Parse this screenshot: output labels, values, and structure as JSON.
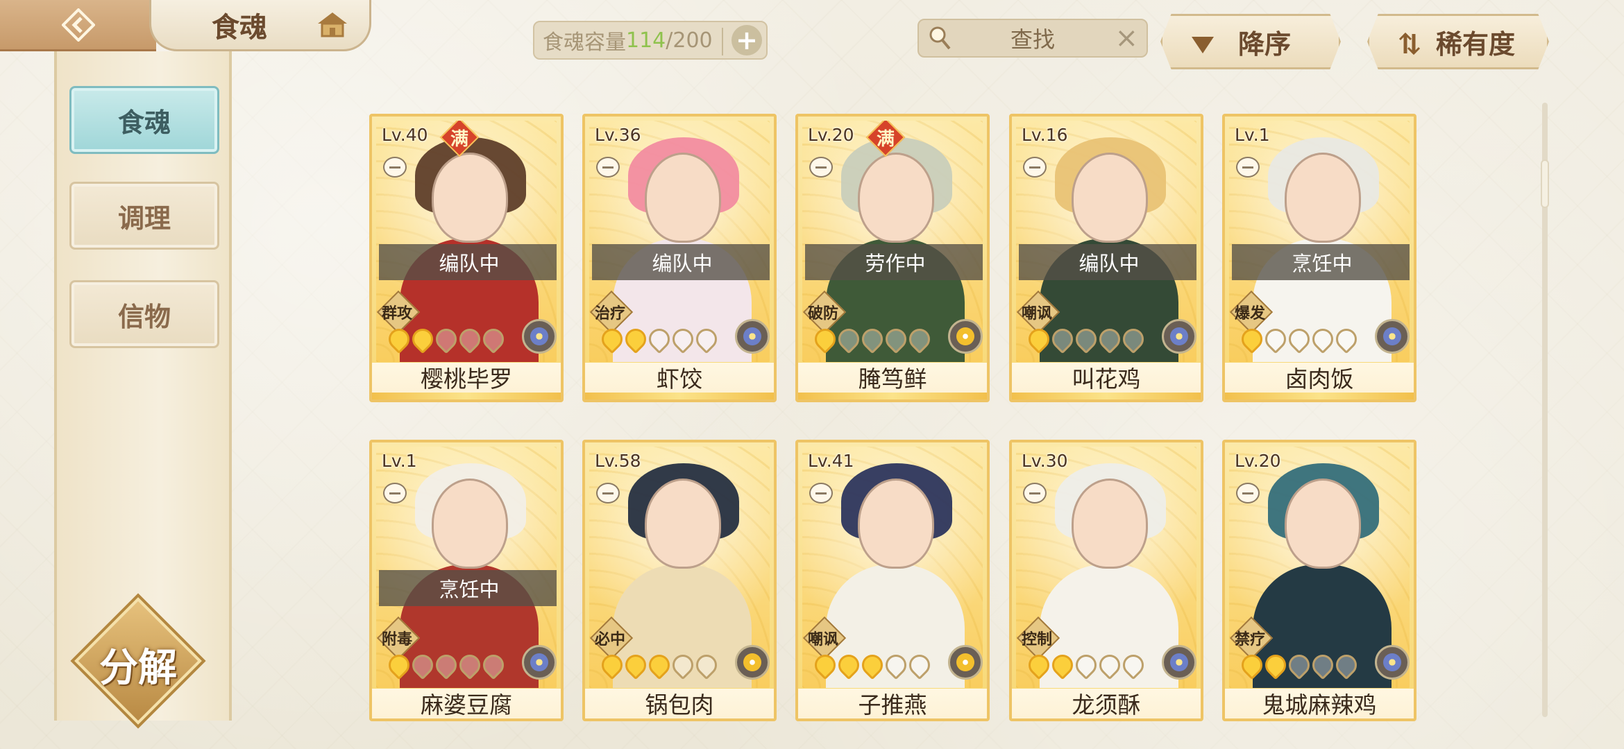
{
  "header": {
    "title": "食魂",
    "capacity": {
      "label": "食魂容量",
      "current": "114",
      "max": "/200"
    },
    "search": {
      "label": "查找"
    },
    "sort_order": "降序",
    "sort_by": "稀有度"
  },
  "sidebar": {
    "tabs": [
      {
        "label": "食魂",
        "active": true
      },
      {
        "label": "调理",
        "active": false
      },
      {
        "label": "信物",
        "active": false
      }
    ],
    "decompose": "分解"
  },
  "colors": {
    "accent_teal": "#9fd6d8",
    "card_gold": "#f7d874",
    "star_on": "#fbcf3c",
    "capacity_current": "#8fc24d"
  },
  "cards": [
    {
      "level": "Lv.40",
      "full": "满",
      "status": "编队中",
      "role": "群攻",
      "stars": 2,
      "element": "blue",
      "name": "樱桃毕罗",
      "hair": "#5a3a26",
      "outfit": "#b5312a"
    },
    {
      "level": "Lv.36",
      "full": "",
      "status": "编队中",
      "role": "治疗",
      "stars": 2,
      "element": "blue",
      "name": "虾饺",
      "hair": "#f28aa0",
      "outfit": "#f3e6ea"
    },
    {
      "level": "Lv.20",
      "full": "满",
      "status": "劳作中",
      "role": "破防",
      "stars": 1,
      "element": "gold",
      "name": "腌笃鲜",
      "hair": "#c8cdbb",
      "outfit": "#3f5a38"
    },
    {
      "level": "Lv.16",
      "full": "",
      "status": "编队中",
      "role": "嘲讽",
      "stars": 1,
      "element": "blue",
      "name": "叫花鸡",
      "hair": "#e8c173",
      "outfit": "#344a36"
    },
    {
      "level": "Lv.1",
      "full": "",
      "status": "烹饪中",
      "role": "爆发",
      "stars": 1,
      "element": "blue",
      "name": "卤肉饭",
      "hair": "#e8e8e4",
      "outfit": "#f6f4ee"
    },
    {
      "level": "Lv.1",
      "full": "",
      "status": "烹饪中",
      "role": "附毒",
      "stars": 1,
      "element": "blue",
      "name": "麻婆豆腐",
      "hair": "#f2efe8",
      "outfit": "#b0372c"
    },
    {
      "level": "Lv.58",
      "full": "",
      "status": "",
      "role": "必中",
      "stars": 3,
      "element": "gold",
      "name": "锅包肉",
      "hair": "#1f2a3e",
      "outfit": "#eddcb4"
    },
    {
      "level": "Lv.41",
      "full": "",
      "status": "",
      "role": "嘲讽",
      "stars": 3,
      "element": "gold",
      "name": "子推燕",
      "hair": "#27305a",
      "outfit": "#f3f0e6"
    },
    {
      "level": "Lv.30",
      "full": "",
      "status": "",
      "role": "控制",
      "stars": 2,
      "element": "blue",
      "name": "龙须酥",
      "hair": "#eeeeea",
      "outfit": "#f5f2ea"
    },
    {
      "level": "Lv.20",
      "full": "",
      "status": "",
      "role": "禁疗",
      "stars": 2,
      "element": "blue",
      "name": "鬼城麻辣鸡",
      "hair": "#2f6a78",
      "outfit": "#243a44"
    }
  ]
}
